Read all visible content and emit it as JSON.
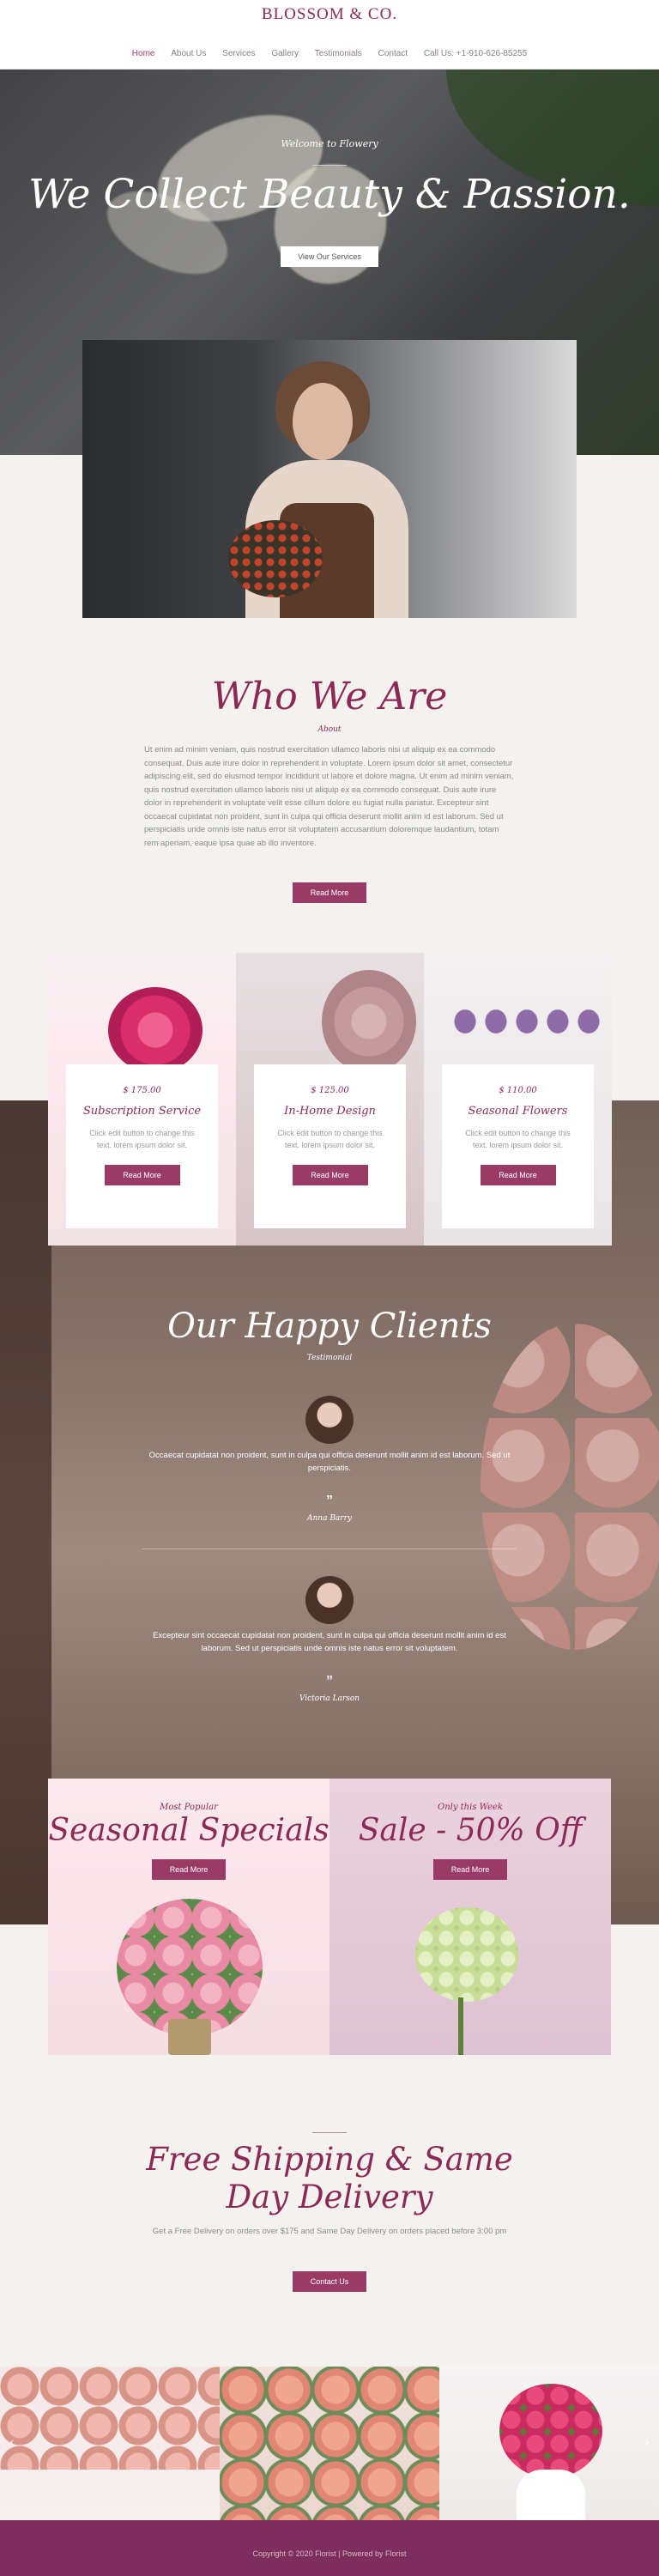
{
  "header": {
    "brand": "BLOSSOM & CO.",
    "nav": [
      {
        "label": "Home",
        "active": true
      },
      {
        "label": "About Us"
      },
      {
        "label": "Services"
      },
      {
        "label": "Gallery"
      },
      {
        "label": "Testimonials"
      },
      {
        "label": "Contact"
      },
      {
        "label": "Call Us: +1-910-626-85255"
      }
    ]
  },
  "hero": {
    "welcome": "Welcome to Flowery",
    "title": "We Collect Beauty & Passion.",
    "button": "View Our Services"
  },
  "about": {
    "title": "Who We Are",
    "subtitle": "About",
    "body": "Ut enim ad minim veniam, quis nostrud exercitation ullamco laboris nisi ut aliquip ex ea commodo consequat. Duis aute irure dolor in reprehenderit in voluptate. Lorem ipsum dolor sit amet, consectetur adipiscing elit, sed do eiusmod tempor incididunt ut labore et dolore magna. Ut enim ad minim veniam, quis nostrud exercitation ullamco laboris nisi ut aliquip ex ea commodo consequat. Duis aute irure dolor in reprehenderit in voluptate velit esse cillum dolore eu fugiat nulla pariatur. Excepteur sint occaecat cupidatat non proident, sunt in culpa qui officia deserunt mollit anim id est laborum. Sed ut perspiciatis unde omnis iste natus error sit voluptatem accusantium doloremque laudantium, totam rem aperiam, eaque ipsa quae ab illo inventore.",
    "button": "Read More"
  },
  "services": [
    {
      "price": "$ 175.00",
      "name": "Subscription Service",
      "text": "Click edit button to change this text. lorem ipsum dolor sit.",
      "button": "Read More"
    },
    {
      "price": "$ 125.00",
      "name": "In-Home Design",
      "text": "Click edit button to change this text. lorem ipsum dolor sit.",
      "button": "Read More"
    },
    {
      "price": "$ 110.00",
      "name": "Seasonal Flowers",
      "text": "Click edit button to change this text. lorem ipsum dolor sit.",
      "button": "Read More"
    }
  ],
  "testimonials": {
    "title": "Our Happy Clients",
    "subtitle": "Testimonial",
    "items": [
      {
        "quote": "Occaecat cupidatat non proident, sunt in culpa qui officia deserunt mollit anim id est laborum. Sed ut perspiciatis.",
        "name": "Anna Barry"
      },
      {
        "quote": "Excepteur sint occaecat cupidatat non proident, sunt in culpa qui officia deserunt mollit anim id est laborum. Sed ut perspiciatis unde omnis iste natus error sit voluptatem.",
        "name": "Victoria Larson"
      }
    ]
  },
  "promos": [
    {
      "kicker": "Most Popular",
      "title": "Seasonal Specials",
      "button": "Read More"
    },
    {
      "kicker": "Only this Week",
      "title": "Sale - 50% Off",
      "button": "Read More"
    }
  ],
  "shipping": {
    "title": "Free Shipping & Same Day Delivery",
    "text": "Get a Free Delivery on orders over $175 and Same Day Delivery on orders placed before 3:00 pm",
    "button": "Contact Us"
  },
  "gallery": {
    "prev": "‹",
    "next": "›"
  },
  "footer": {
    "copyright": "Copyright © 2020 Florist | Powered by Florist"
  },
  "colors": {
    "accent": "#8c2955",
    "button": "#9a3b67",
    "footer": "#7d2e5c"
  }
}
